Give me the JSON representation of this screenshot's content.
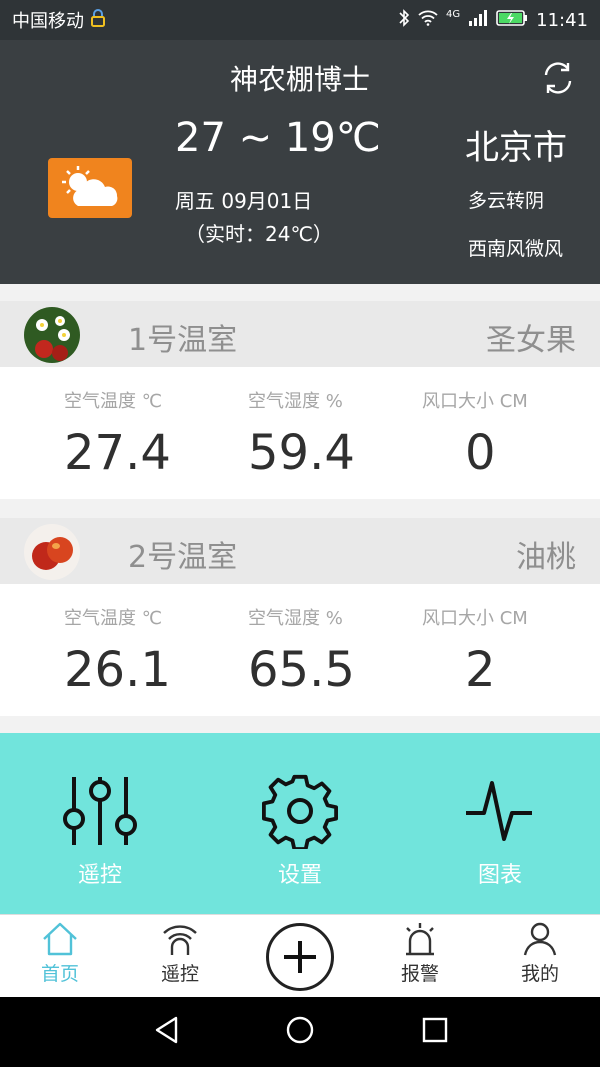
{
  "status_bar": {
    "carrier": "中国移动",
    "network": "4G",
    "time": "11:41",
    "icons": [
      "lock-icon",
      "bluetooth-icon",
      "wifi-icon",
      "signal-icon",
      "battery-icon"
    ]
  },
  "weather": {
    "app_title": "神农棚博士",
    "temp_range": "27 ~ 19℃",
    "date": "周五 09月01日",
    "realtime": "（实时：24℃）",
    "city": "北京市",
    "condition": "多云转阴",
    "wind": "西南风微风",
    "icon": "partly-cloudy-icon"
  },
  "greenhouses": [
    {
      "name": "1号温室",
      "crop": "圣女果",
      "metrics": [
        {
          "label": "空气温度 ℃",
          "value": "27.4"
        },
        {
          "label": "空气湿度 %",
          "value": "59.4"
        },
        {
          "label": "风口大小 CM",
          "value": "0"
        }
      ]
    },
    {
      "name": "2号温室",
      "crop": "油桃",
      "metrics": [
        {
          "label": "空气温度 ℃",
          "value": "26.1"
        },
        {
          "label": "空气湿度 %",
          "value": "65.5"
        },
        {
          "label": "风口大小 CM",
          "value": "2"
        }
      ]
    }
  ],
  "actions": [
    {
      "label": "遥控",
      "icon": "sliders-icon"
    },
    {
      "label": "设置",
      "icon": "gear-icon"
    },
    {
      "label": "图表",
      "icon": "pulse-chart-icon"
    }
  ],
  "bottom_nav": [
    {
      "label": "首页",
      "icon": "home-icon",
      "active": true
    },
    {
      "label": "遥控",
      "icon": "remote-icon",
      "active": false
    },
    {
      "label": "",
      "icon": "add-icon",
      "active": false
    },
    {
      "label": "报警",
      "icon": "alarm-icon",
      "active": false
    },
    {
      "label": "我的",
      "icon": "user-icon",
      "active": false
    }
  ],
  "colors": {
    "header_bg": "#3a3f42",
    "sun_badge": "#f0841e",
    "action_panel": "#71e4dc",
    "nav_active": "#51c2d8"
  }
}
